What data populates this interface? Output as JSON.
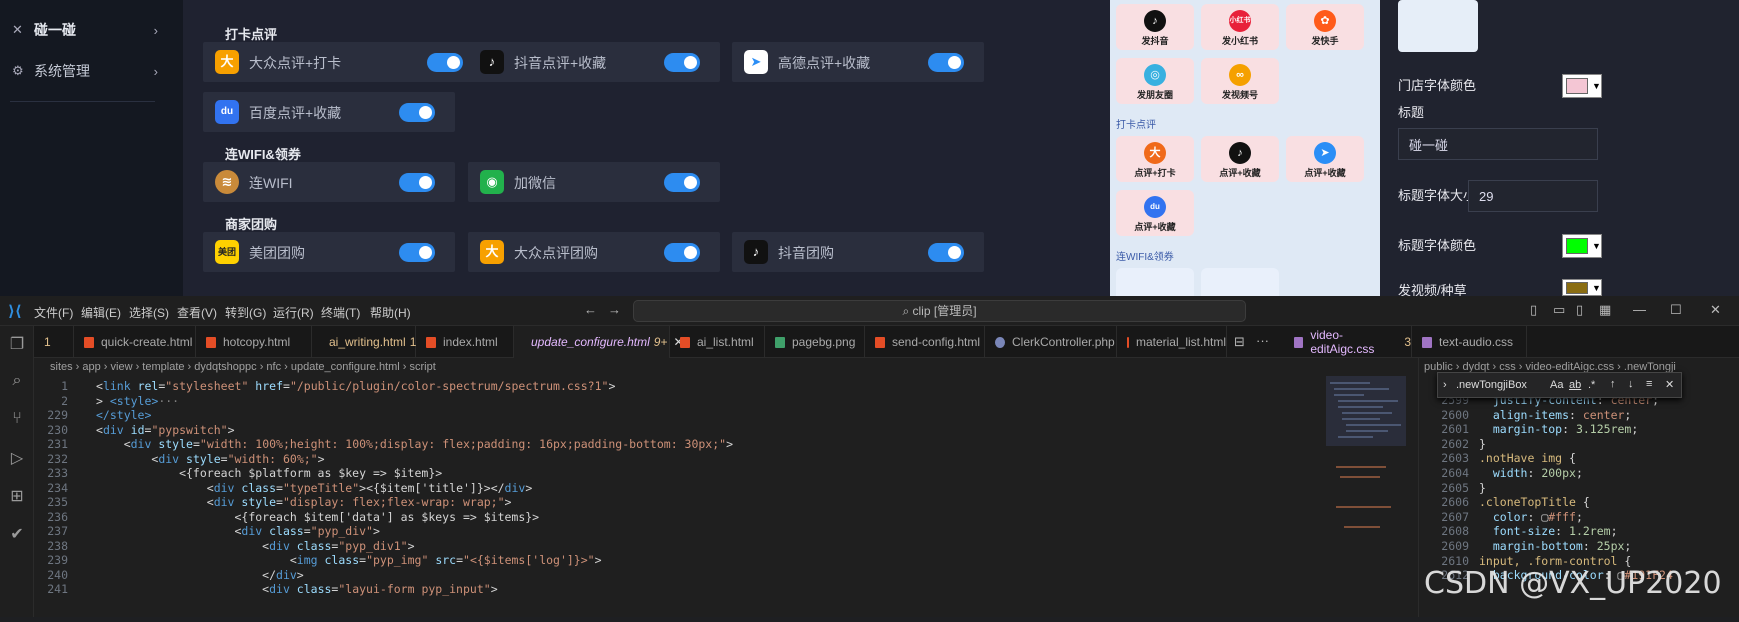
{
  "sidebar": {
    "items": [
      {
        "icon": "✕",
        "label": "碰一碰",
        "arrow": "›"
      },
      {
        "icon": "⚙",
        "label": "系统管理",
        "arrow": "›"
      }
    ]
  },
  "sections": {
    "checkin": "打卡点评",
    "wifi": "连WIFI&领券",
    "group": "商家团购"
  },
  "cards": [
    {
      "icon": "dianping-icon",
      "glyph": "大",
      "color": "#f7a000",
      "label": "大众点评+打卡"
    },
    {
      "icon": "douyin-icon",
      "glyph": "♪",
      "color": "#111111",
      "label": "抖音点评+收藏"
    },
    {
      "icon": "amap-icon",
      "glyph": "➤",
      "color": "#2b8ef6",
      "label": "高德点评+收藏"
    },
    {
      "icon": "baidu-icon",
      "glyph": "du",
      "color": "#3273f0",
      "label": "百度点评+收藏"
    },
    {
      "icon": "wifi-icon",
      "glyph": "≋",
      "color": "#c98a3a",
      "label": "连WIFI"
    },
    {
      "icon": "wechat-icon",
      "glyph": "◉",
      "color": "#22b14c",
      "label": "加微信"
    },
    {
      "icon": "meituan-icon",
      "glyph": "美团",
      "color": "#ffd100",
      "label": "美团团购"
    },
    {
      "icon": "dianping-group-icon",
      "glyph": "大",
      "color": "#f7a000",
      "label": "大众点评团购"
    },
    {
      "icon": "douyin-group-icon",
      "glyph": "♪",
      "color": "#111111",
      "label": "抖音团购"
    }
  ],
  "phone": {
    "sec_checkin": "打卡点评",
    "sec_wifi": "连WIFI&领券",
    "tiles": [
      {
        "label": "发抖音",
        "color": "#111111",
        "glyph": "♪"
      },
      {
        "label": "发小红书",
        "color": "#e8213a",
        "glyph": "小红书"
      },
      {
        "label": "发快手",
        "color": "#ff5b1a",
        "glyph": "✿"
      },
      {
        "label": "发朋友圈",
        "color": "#38b0e0",
        "glyph": "◎"
      },
      {
        "label": "发视频号",
        "color": "#f5a000",
        "glyph": "∞"
      },
      {
        "label": "点评+打卡",
        "color": "#f06a1a",
        "glyph": "大"
      },
      {
        "label": "点评+收藏",
        "color": "#111111",
        "glyph": "♪"
      },
      {
        "label": "点评+收藏",
        "color": "#2b8ef6",
        "glyph": "➤"
      },
      {
        "label": "点评+收藏",
        "color": "#3273f0",
        "glyph": "du"
      }
    ]
  },
  "rightpanel": {
    "store_font_color_label": "门店字体颜色",
    "title_label": "标题",
    "title_value": "碰一碰",
    "title_size_label": "标题字体大小",
    "title_size_value": "29",
    "title_color_label": "标题字体颜色",
    "video_label": "发视频/种草",
    "colors": {
      "store": "#f4c6d4",
      "title": "#00ff00",
      "video": "#8a6d12"
    }
  },
  "vscode": {
    "menu": [
      "文件(F)",
      "编辑(E)",
      "选择(S)",
      "查看(V)",
      "转到(G)",
      "运行(R)",
      "终端(T)",
      "帮助(H)"
    ],
    "search": "clip [管理员]",
    "tabs": [
      {
        "name": "1",
        "modified": ""
      },
      {
        "name": "quick-create.html",
        "modified": ""
      },
      {
        "name": "hotcopy.html",
        "modified": ""
      },
      {
        "name": "ai_writing.html",
        "modified": "1"
      },
      {
        "name": "index.html",
        "modified": ""
      },
      {
        "name": "update_configure.html",
        "modified": "9+"
      },
      {
        "name": "ai_list.html",
        "modified": ""
      },
      {
        "name": "pagebg.png",
        "modified": ""
      },
      {
        "name": "send-config.html",
        "modified": ""
      },
      {
        "name": "ClerkController.php",
        "modified": ""
      },
      {
        "name": "material_list.html",
        "modified": ""
      }
    ],
    "right_tabs": [
      {
        "name": "video-editAigc.css",
        "modified": "3"
      },
      {
        "name": "text-audio.css",
        "modified": ""
      }
    ],
    "breadcrumb": "sites › app › view › template › dydqtshoppc › nfc › update_configure.html › script",
    "right_breadcrumb": "public › dydqt › css › video-editAigc.css › .newTongji",
    "find_text": ".newTongjiBox",
    "lines": [
      {
        "n": "1",
        "parts": [
          [
            "pl",
            "<"
          ],
          [
            "tg",
            "link "
          ],
          [
            "at",
            "rel"
          ],
          [
            "pl",
            "="
          ],
          [
            "st",
            "\"stylesheet\" "
          ],
          [
            "at",
            "href"
          ],
          [
            "pl",
            "="
          ],
          [
            "st",
            "\"/public/plugin/color-spectrum/spectrum.css?1\""
          ],
          [
            "pl",
            ">"
          ]
        ]
      },
      {
        "n": "2",
        "parts": [
          [
            "pl",
            "> "
          ],
          [
            "tg",
            "<style>"
          ],
          [
            "gy",
            "···"
          ]
        ]
      },
      {
        "n": "229",
        "parts": [
          [
            "tg",
            "</style>"
          ]
        ]
      },
      {
        "n": "230",
        "parts": [
          [
            "pl",
            "<"
          ],
          [
            "tg",
            "div "
          ],
          [
            "at",
            "id"
          ],
          [
            "pl",
            "="
          ],
          [
            "st",
            "\"pypswitch\""
          ],
          [
            "pl",
            ">"
          ]
        ]
      },
      {
        "n": "231",
        "parts": [
          [
            "pl",
            "    <"
          ],
          [
            "tg",
            "div "
          ],
          [
            "at",
            "style"
          ],
          [
            "pl",
            "="
          ],
          [
            "st",
            "\"width: 100%;height: 100%;display: flex;padding: 16px;padding-bottom: 30px;\""
          ],
          [
            "pl",
            ">"
          ]
        ]
      },
      {
        "n": "232",
        "parts": [
          [
            "pl",
            "        <"
          ],
          [
            "tg",
            "div "
          ],
          [
            "at",
            "style"
          ],
          [
            "pl",
            "="
          ],
          [
            "st",
            "\"width: 60%;\""
          ],
          [
            "pl",
            ">"
          ]
        ]
      },
      {
        "n": "233",
        "parts": [
          [
            "pl",
            "            <{foreach $platform as $key => $item}>"
          ]
        ]
      },
      {
        "n": "234",
        "parts": [
          [
            "pl",
            "                <"
          ],
          [
            "tg",
            "div "
          ],
          [
            "at",
            "class"
          ],
          [
            "pl",
            "="
          ],
          [
            "st",
            "\"typeTitle\""
          ],
          [
            "pl",
            "><{$item['title']}></"
          ],
          [
            "tg",
            "div"
          ],
          [
            "pl",
            ">"
          ]
        ]
      },
      {
        "n": "235",
        "parts": [
          [
            "pl",
            "                <"
          ],
          [
            "tg",
            "div "
          ],
          [
            "at",
            "style"
          ],
          [
            "pl",
            "="
          ],
          [
            "st",
            "\"display: flex;flex-wrap: wrap;\""
          ],
          [
            "pl",
            ">"
          ]
        ]
      },
      {
        "n": "236",
        "parts": [
          [
            "pl",
            "                    <{foreach $item['data'] as $keys => $items}>"
          ]
        ]
      },
      {
        "n": "237",
        "parts": [
          [
            "pl",
            "                    <"
          ],
          [
            "tg",
            "div "
          ],
          [
            "at",
            "class"
          ],
          [
            "pl",
            "="
          ],
          [
            "st",
            "\"pyp_div\""
          ],
          [
            "pl",
            ">"
          ]
        ]
      },
      {
        "n": "238",
        "parts": [
          [
            "pl",
            "                        <"
          ],
          [
            "tg",
            "div "
          ],
          [
            "at",
            "class"
          ],
          [
            "pl",
            "="
          ],
          [
            "st",
            "\"pyp_div1\""
          ],
          [
            "pl",
            ">"
          ]
        ]
      },
      {
        "n": "239",
        "parts": [
          [
            "pl",
            "                            <"
          ],
          [
            "tg",
            "img "
          ],
          [
            "at",
            "class"
          ],
          [
            "pl",
            "="
          ],
          [
            "st",
            "\"pyp_img\" "
          ],
          [
            "at",
            "src"
          ],
          [
            "pl",
            "="
          ],
          [
            "st",
            "\"<{$items['log']}>\""
          ],
          [
            "pl",
            ">"
          ]
        ]
      },
      {
        "n": "240",
        "parts": [
          [
            "pl",
            "                        </"
          ],
          [
            "tg",
            "div"
          ],
          [
            "pl",
            ">"
          ]
        ]
      },
      {
        "n": "241",
        "parts": [
          [
            "pl",
            "                        <"
          ],
          [
            "tg",
            "div "
          ],
          [
            "at",
            "class"
          ],
          [
            "pl",
            "="
          ],
          [
            "st",
            "\"layui-form pyp_input\""
          ],
          [
            "pl",
            ">"
          ]
        ]
      }
    ],
    "rlines": [
      {
        "n": "2599",
        "parts": [
          [
            "prop",
            "  justify-content"
          ],
          [
            "pn",
            ": "
          ],
          [
            "val",
            "center"
          ],
          [
            "pn",
            ";"
          ]
        ]
      },
      {
        "n": "2600",
        "parts": [
          [
            "prop",
            "  align-items"
          ],
          [
            "pn",
            ": "
          ],
          [
            "val",
            "center"
          ],
          [
            "pn",
            ";"
          ]
        ]
      },
      {
        "n": "2601",
        "parts": [
          [
            "prop",
            "  margin-top"
          ],
          [
            "pn",
            ": "
          ],
          [
            "num",
            "3.125rem"
          ],
          [
            "pn",
            ";"
          ]
        ]
      },
      {
        "n": "2602",
        "parts": [
          [
            "pn",
            "}"
          ]
        ]
      },
      {
        "n": "2603",
        "parts": [
          [
            "sel",
            ".notHave img "
          ],
          [
            "pn",
            "{"
          ]
        ]
      },
      {
        "n": "2604",
        "parts": [
          [
            "prop",
            "  width"
          ],
          [
            "pn",
            ": "
          ],
          [
            "num",
            "200px"
          ],
          [
            "pn",
            ";"
          ]
        ]
      },
      {
        "n": "2605",
        "parts": [
          [
            "pn",
            "}"
          ]
        ]
      },
      {
        "n": "2606",
        "parts": [
          [
            "sel",
            ".cloneTopTitle "
          ],
          [
            "pn",
            "{"
          ]
        ]
      },
      {
        "n": "2607",
        "parts": [
          [
            "prop",
            "  color"
          ],
          [
            "pn",
            ": ▢"
          ],
          [
            "val",
            "#fff"
          ],
          [
            "pn",
            ";"
          ]
        ]
      },
      {
        "n": "2608",
        "parts": [
          [
            "prop",
            "  font-size"
          ],
          [
            "pn",
            ": "
          ],
          [
            "num",
            "1.2rem"
          ],
          [
            "pn",
            ";"
          ]
        ]
      },
      {
        "n": "2609",
        "parts": [
          [
            "prop",
            "  margin-bottom"
          ],
          [
            "pn",
            ": "
          ],
          [
            "num",
            "25px"
          ],
          [
            "pn",
            ";"
          ]
        ]
      },
      {
        "n": "2610",
        "parts": [
          [
            "sel",
            "input, .form-control "
          ],
          [
            "pn",
            "{"
          ]
        ]
      },
      {
        "n": "2612",
        "parts": [
          [
            "prop",
            "  background-color"
          ],
          [
            "pn",
            ": ▢"
          ],
          [
            "val",
            "#191F24"
          ]
        ]
      }
    ]
  },
  "watermark": "CSDN @VX_UP2020"
}
